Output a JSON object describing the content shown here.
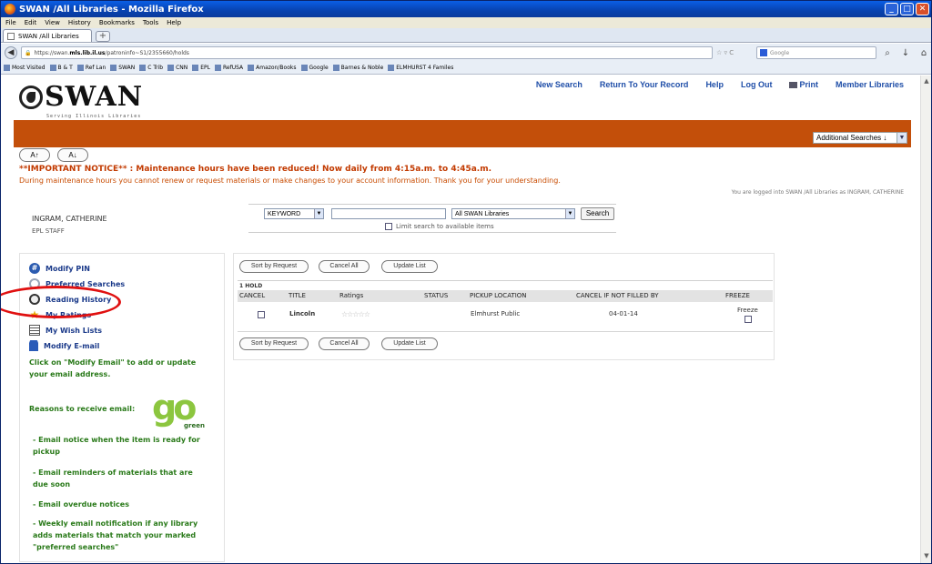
{
  "window": {
    "title": "SWAN /All Libraries - Mozilla Firefox",
    "controls": [
      "_",
      "□",
      "✕"
    ]
  },
  "menu": [
    "File",
    "Edit",
    "View",
    "History",
    "Bookmarks",
    "Tools",
    "Help"
  ],
  "tab": {
    "label": "SWAN /All Libraries",
    "new_tab": "+"
  },
  "nav": {
    "url_prefix": "https://swan.",
    "url_domain": "mls.lib.il.us",
    "url_rest": "/patroninfo~S1/2355660/holds",
    "search_placeholder": "Google"
  },
  "bookmarks": [
    "Most Visited",
    "B & T",
    "Ref Lan",
    "SWAN",
    "C Trib",
    "CNN",
    "EPL",
    "RefUSA",
    "Amazon/Books",
    "Google",
    "Barnes & Noble",
    "ELMHURST 4 Familes"
  ],
  "header": {
    "logo_text": "SWAN",
    "logo_sub": "Serving Illinois Libraries",
    "links": [
      "New Search",
      "Return To Your Record",
      "Help",
      "Log Out",
      "Print",
      "Member Libraries"
    ],
    "additional_searches": "Additional Searches ↓"
  },
  "font_buttons": [
    "A↑",
    "A↓"
  ],
  "notice": {
    "line1": "**IMPORTANT NOTICE** : Maintenance hours have been reduced! Now daily from 4:15a.m. to 4:45a.m.",
    "line2": "During maintenance hours you cannot renew or request materials or make changes to your account information. Thank you for your understanding."
  },
  "logged_in": "You are logged into SWAN /All Libraries as INGRAM, CATHERINE",
  "patron": {
    "name": "INGRAM, CATHERINE",
    "status": "EPL STAFF"
  },
  "search": {
    "type": "KEYWORD",
    "value": "",
    "scope": "All SWAN Libraries",
    "button": "Search",
    "limit_label": "Limit search to available items"
  },
  "sidebar": {
    "items": [
      {
        "label": "Modify PIN"
      },
      {
        "label": "Preferred Searches"
      },
      {
        "label": "Reading History"
      },
      {
        "label": "My Ratings"
      },
      {
        "label": "My Wish Lists"
      },
      {
        "label": "Modify E-mail"
      }
    ],
    "email_hint": "Click on \"Modify Email\" to add or update your email address.",
    "reasons_title": "Reasons to receive email:",
    "go_green": {
      "go": "go",
      "green": "green"
    },
    "reasons": [
      "- Email notice when the item is ready for pickup",
      "- Email reminders of materials that are due soon",
      "- Email overdue notices",
      "- Weekly email notification if any library adds materials that match your marked \"preferred searches\""
    ]
  },
  "holds": {
    "buttons": [
      "Sort by Request",
      "Cancel All",
      "Update List"
    ],
    "count_label": "1 HOLD",
    "columns": [
      "CANCEL",
      "TITLE",
      "Ratings",
      "STATUS",
      "PICKUP LOCATION",
      "CANCEL IF NOT FILLED BY",
      "FREEZE"
    ],
    "rows": [
      {
        "title": "Lincoln",
        "ratings": "☆☆☆☆☆",
        "status": "",
        "pickup": "Elmhurst Public",
        "cancel_by": "04-01-14",
        "freeze_label": "Freeze"
      }
    ]
  }
}
